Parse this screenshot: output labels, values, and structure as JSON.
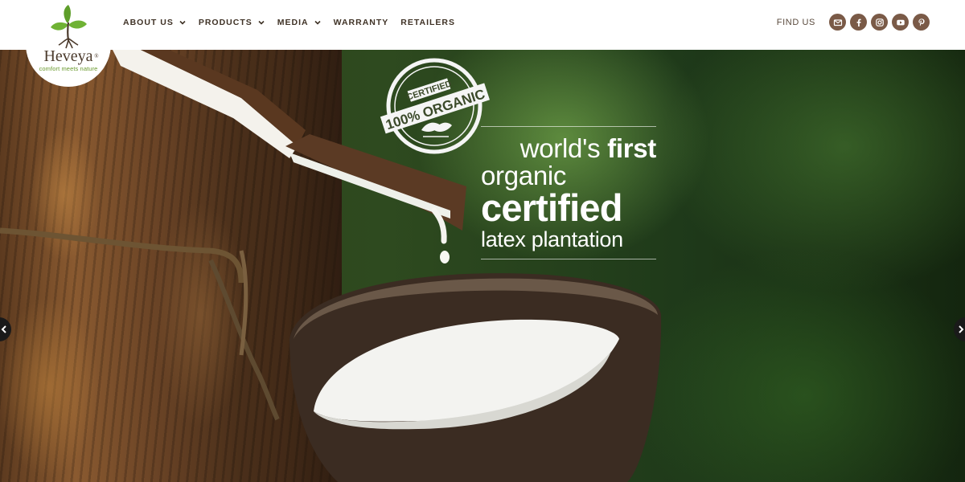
{
  "brand": {
    "name": "Heveya",
    "registered": "®",
    "tagline": "comfort meets nature"
  },
  "nav": {
    "items": [
      {
        "label": "ABOUT US",
        "has_dropdown": true
      },
      {
        "label": "PRODUCTS",
        "has_dropdown": true
      },
      {
        "label": "MEDIA",
        "has_dropdown": true
      },
      {
        "label": "WARRANTY",
        "has_dropdown": false
      },
      {
        "label": "RETAILERS",
        "has_dropdown": false
      }
    ]
  },
  "findus": {
    "label": "FIND US",
    "icons": [
      "email-icon",
      "facebook-icon",
      "instagram-icon",
      "youtube-icon",
      "pinterest-icon"
    ]
  },
  "hero": {
    "stamp": {
      "line1": "CERTIFIED",
      "line2": "100% ORGANIC"
    },
    "slogan": {
      "line1_regular": "world's ",
      "line1_bold": "first",
      "line2": "organic",
      "line3": "certified",
      "line4": "latex plantation"
    }
  },
  "colors": {
    "brand_brown": "#7a5a47",
    "nav_text": "#3f3226",
    "logo_green": "#6a9a2e"
  }
}
